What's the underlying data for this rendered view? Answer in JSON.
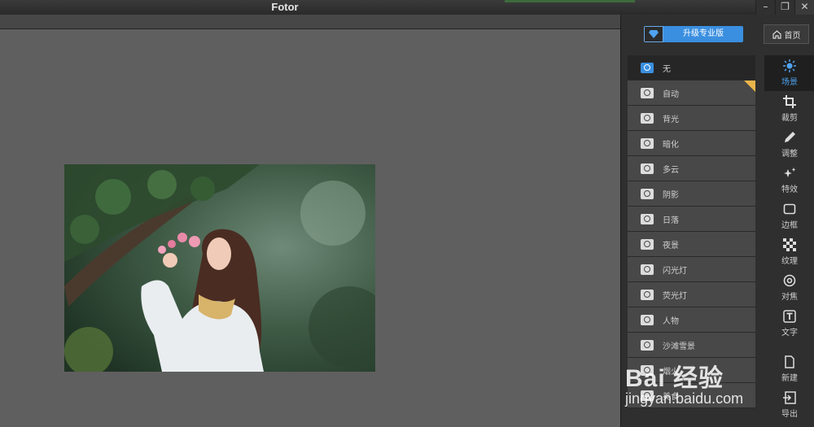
{
  "window": {
    "title": "Fotor",
    "controls": [
      "–",
      "❐",
      "✕"
    ]
  },
  "toolbar": {
    "upgrade_label": "升级专业版",
    "home_label": "首页"
  },
  "scenes": [
    {
      "label": "无",
      "active": true
    },
    {
      "label": "自动",
      "badge": true
    },
    {
      "label": "背光"
    },
    {
      "label": "暗化"
    },
    {
      "label": "多云"
    },
    {
      "label": "阴影"
    },
    {
      "label": "日落"
    },
    {
      "label": "夜景"
    },
    {
      "label": "闪光灯"
    },
    {
      "label": "荧光灯"
    },
    {
      "label": "人物"
    },
    {
      "label": "沙滩雪景"
    },
    {
      "label": "烟火"
    },
    {
      "label": "美食"
    }
  ],
  "tools": [
    {
      "label": "场景",
      "icon": "sun-icon",
      "active": true
    },
    {
      "label": "裁剪",
      "icon": "crop-icon"
    },
    {
      "label": "调整",
      "icon": "pencil-icon"
    },
    {
      "label": "特效",
      "icon": "sparkle-icon"
    },
    {
      "label": "边框",
      "icon": "frame-icon"
    },
    {
      "label": "纹理",
      "icon": "checker-icon"
    },
    {
      "label": "对焦",
      "icon": "focus-icon"
    },
    {
      "label": "文字",
      "icon": "text-icon"
    },
    {
      "label": "",
      "icon": "",
      "spacer": true
    },
    {
      "label": "新建",
      "icon": "new-file-icon"
    },
    {
      "label": "导出",
      "icon": "export-icon"
    }
  ],
  "watermark": {
    "brand": "Bai 经验",
    "url": "jingyan.baidu.com"
  },
  "colors": {
    "accent": "#3a8fe0",
    "panel": "#2f2f2f",
    "canvas": "#5f5f5f",
    "badge": "#e9b54a"
  }
}
